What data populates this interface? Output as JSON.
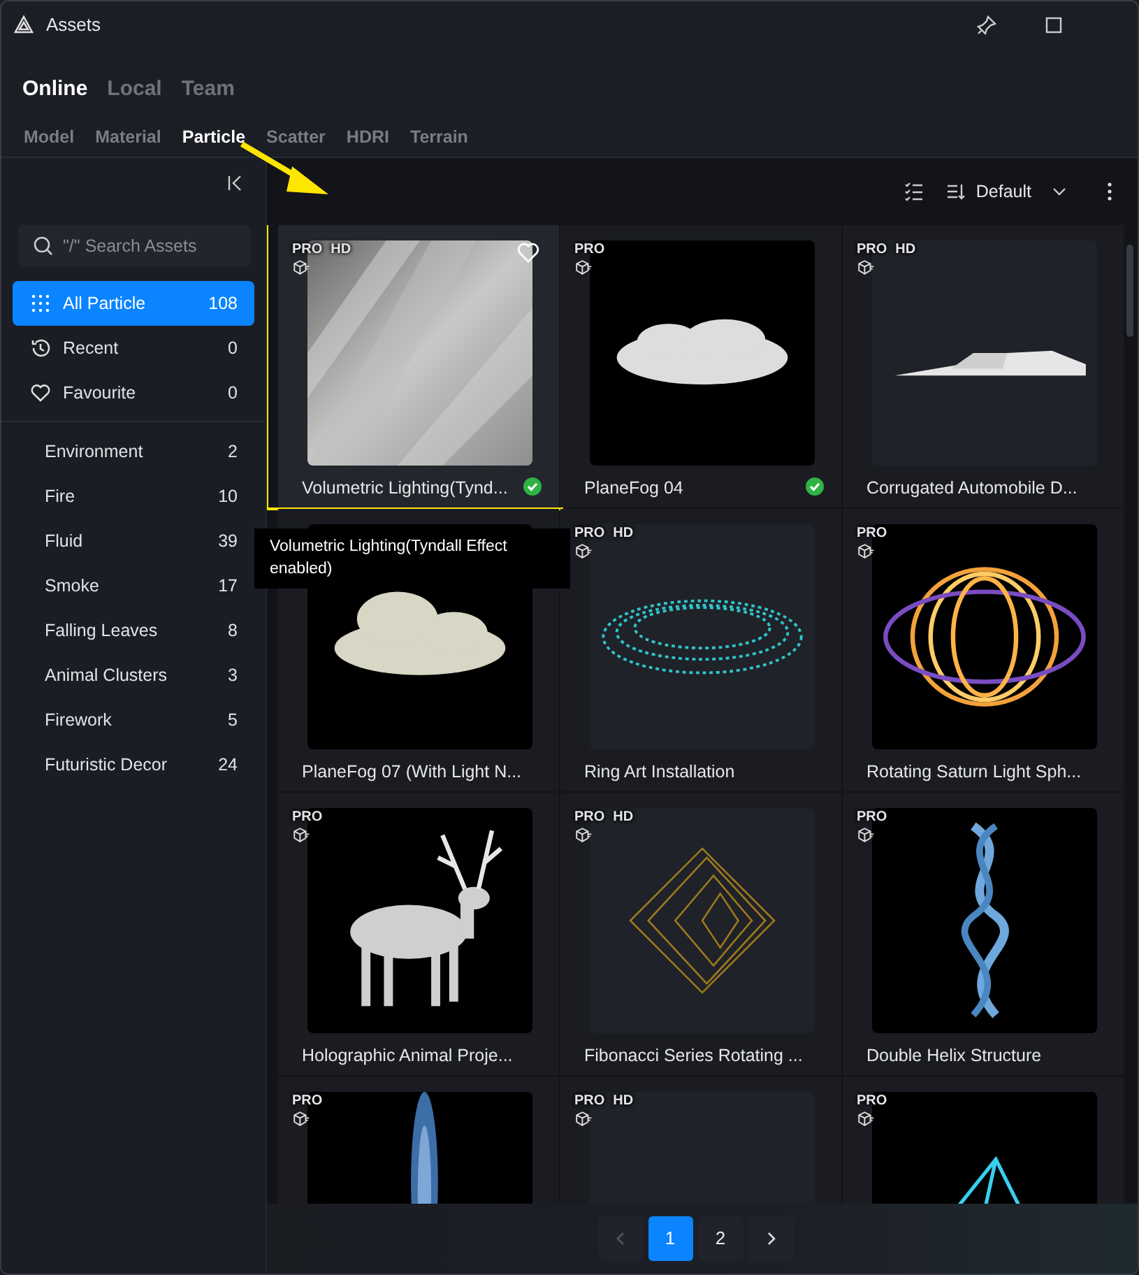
{
  "window": {
    "title": "Assets"
  },
  "source_tabs": [
    {
      "label": "Online",
      "selected": true
    },
    {
      "label": "Local",
      "selected": false
    },
    {
      "label": "Team",
      "selected": false
    }
  ],
  "category_tabs": [
    {
      "label": "Model",
      "selected": false
    },
    {
      "label": "Material",
      "selected": false
    },
    {
      "label": "Particle",
      "selected": true
    },
    {
      "label": "Scatter",
      "selected": false
    },
    {
      "label": "HDRI",
      "selected": false
    },
    {
      "label": "Terrain",
      "selected": false
    }
  ],
  "sidebar": {
    "search": {
      "placeholder": "\"/\" Search Assets"
    },
    "quick": [
      {
        "kind": "all",
        "label": "All Particle",
        "count": "108",
        "selected": true
      },
      {
        "kind": "recent",
        "label": "Recent",
        "count": "0",
        "selected": false
      },
      {
        "kind": "favourite",
        "label": "Favourite",
        "count": "0",
        "selected": false
      }
    ],
    "categories": [
      {
        "label": "Environment",
        "count": "2"
      },
      {
        "label": "Fire",
        "count": "10"
      },
      {
        "label": "Fluid",
        "count": "39"
      },
      {
        "label": "Smoke",
        "count": "17"
      },
      {
        "label": "Falling Leaves",
        "count": "8"
      },
      {
        "label": "Animal Clusters",
        "count": "3"
      },
      {
        "label": "Firework",
        "count": "5"
      },
      {
        "label": "Futuristic Decor",
        "count": "24"
      }
    ]
  },
  "toolbar": {
    "sort": "Default"
  },
  "assets": [
    {
      "name": "Volumetric Lighting(Tynd...",
      "badges": [
        "PRO",
        "HD"
      ],
      "downloaded": true,
      "hovered": true,
      "highlighted": true,
      "kind": "picture"
    },
    {
      "name": "PlaneFog 04",
      "badges": [
        "PRO"
      ],
      "downloaded": true,
      "hovered": false,
      "highlighted": false,
      "kind": "picture"
    },
    {
      "name": "Corrugated Automobile D...",
      "badges": [
        "PRO",
        "HD"
      ],
      "downloaded": false,
      "hovered": false,
      "highlighted": false,
      "kind": "picture"
    },
    {
      "name": "PlaneFog 07 (With Light N...",
      "downloaded": false,
      "hovered": false,
      "highlighted": false,
      "kind": "picture"
    },
    {
      "name": "Ring Art Installation",
      "badges": [
        "PRO",
        "HD"
      ],
      "downloaded": false,
      "hovered": false,
      "highlighted": false,
      "kind": "picture"
    },
    {
      "name": "Rotating Saturn Light Sph...",
      "badges": [
        "PRO"
      ],
      "downloaded": false,
      "hovered": false,
      "highlighted": false,
      "kind": "picture"
    },
    {
      "name": "Holographic Animal Proje...",
      "badges": [
        "PRO"
      ],
      "downloaded": false,
      "hovered": false,
      "highlighted": false,
      "kind": "picture"
    },
    {
      "name": "Fibonacci Series Rotating ...",
      "badges": [
        "PRO",
        "HD"
      ],
      "downloaded": false,
      "hovered": false,
      "highlighted": false,
      "kind": "picture"
    },
    {
      "name": "Double Helix Structure",
      "badges": [
        "PRO"
      ],
      "downloaded": false,
      "hovered": false,
      "highlighted": false,
      "kind": "picture"
    },
    {
      "badges": [
        "PRO"
      ],
      "hovered": false,
      "highlighted": false,
      "kind": "picture"
    },
    {
      "badges": [
        "PRO",
        "HD"
      ],
      "hovered": false,
      "highlighted": false,
      "kind": "picture"
    },
    {
      "badges": [
        "PRO"
      ],
      "hovered": false,
      "highlighted": false,
      "kind": "picture"
    }
  ],
  "tooltip": "Volumetric Lighting(Tyndall Effect enabled)",
  "pagination": {
    "pages": [
      {
        "label": "1",
        "selected": true
      },
      {
        "label": "2",
        "selected": false
      }
    ],
    "prev_disabled": true
  }
}
